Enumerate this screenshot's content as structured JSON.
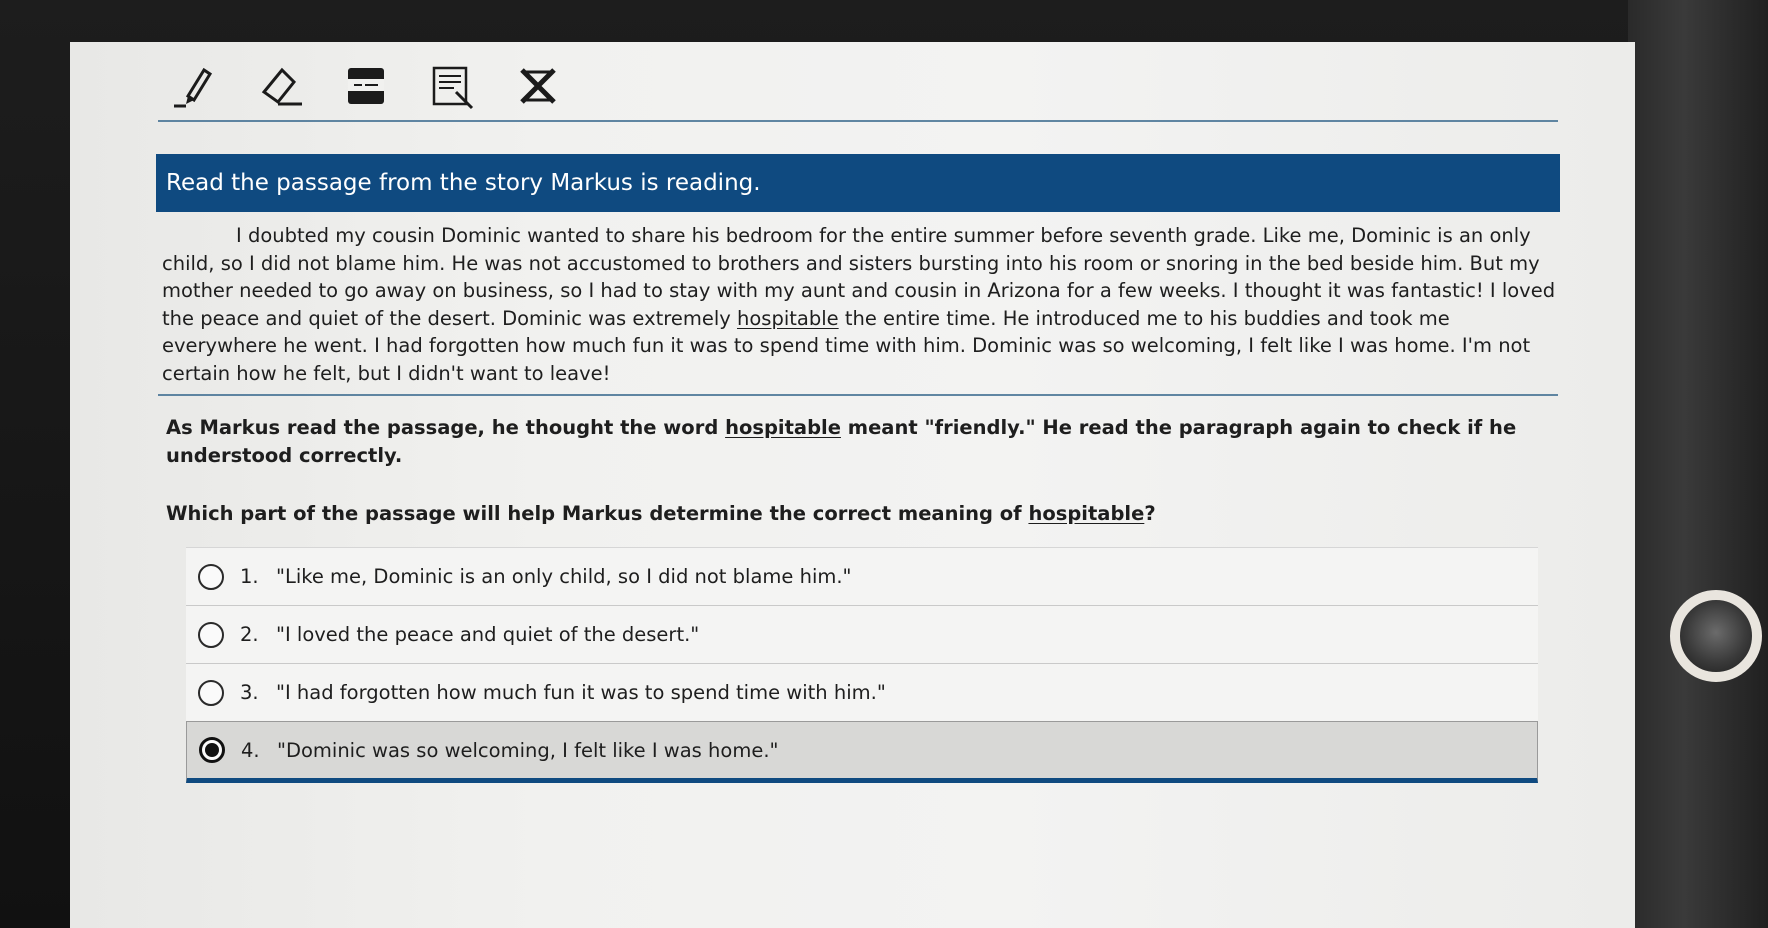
{
  "toolbar": {
    "tools": [
      "highlighter-icon",
      "eraser-icon",
      "line-reader-icon",
      "notepad-icon",
      "answer-eliminator-icon"
    ]
  },
  "prompt": {
    "text": "Read the passage from the story Markus is reading."
  },
  "passage": {
    "before": "I doubted my cousin Dominic wanted to share his bedroom for the entire summer before seventh grade. Like me, Dominic is an only child, so I did not blame him. He was not accustomed to brothers and sisters bursting into his room or snoring in the bed beside him. But my mother needed to go away on business, so I had to stay with my aunt and cousin in Arizona for a few weeks. I thought it was fantastic! I loved the peace and quiet of the desert. Dominic was extremely ",
    "keyword": "hospitable",
    "after": " the entire time. He introduced me to his buddies and took me everywhere he went. I had forgotten how much fun it was to spend time with him. Dominic was so welcoming, I felt like I was home. I'm not certain how he felt, but I didn't want to leave!"
  },
  "context": {
    "before": "As Markus read the passage, he thought the word ",
    "keyword": "hospitable",
    "after": " meant \"friendly.\" He read the paragraph again to check if he understood correctly."
  },
  "question": {
    "before": "Which part of the passage will help Markus determine the correct meaning of ",
    "keyword": "hospitable",
    "after": "?"
  },
  "answers": [
    {
      "num": "1.",
      "text": "\"Like me, Dominic is an only child, so I did not blame him.\"",
      "selected": false
    },
    {
      "num": "2.",
      "text": "\"I loved the peace and quiet of the desert.\"",
      "selected": false
    },
    {
      "num": "3.",
      "text": "\"I had forgotten how much fun it was to spend time with him.\"",
      "selected": false
    },
    {
      "num": "4.",
      "text": "\"Dominic was so welcoming, I felt like I was home.\"",
      "selected": true
    }
  ],
  "colors": {
    "accent": "#0f4a80",
    "text": "#1e1e1e"
  }
}
